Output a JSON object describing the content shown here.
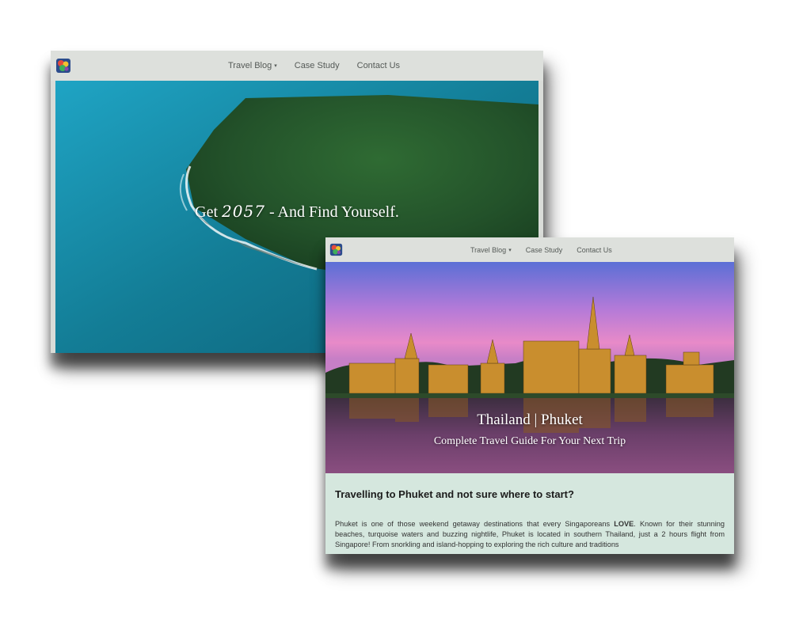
{
  "back_window": {
    "nav": {
      "items": [
        {
          "label": "Travel Blog",
          "has_dropdown": true
        },
        {
          "label": "Case Study"
        },
        {
          "label": "Contact Us"
        }
      ]
    },
    "hero": {
      "title_prefix": "Get ",
      "brand": "2057",
      "title_suffix": " - And Find Yourself."
    }
  },
  "front_window": {
    "nav": {
      "items": [
        {
          "label": "Travel Blog",
          "has_dropdown": true
        },
        {
          "label": "Case Study"
        },
        {
          "label": "Contact Us"
        }
      ]
    },
    "hero": {
      "title": "Thailand | Phuket",
      "subtitle": "Complete Travel Guide For Your Next Trip"
    },
    "article": {
      "heading": "Travelling to Phuket and not sure where to start?",
      "body_before_emphasis": "Phuket is one of those weekend getaway destinations that every Singaporeans ",
      "emphasis": "LOVE",
      "body_after_emphasis": ". Known for their stunning beaches, turquoise waters and buzzing nightlife, Phuket is located in southern Thailand, just a 2 hours flight from Singapore! From snorkling and island-hopping to exploring the rich culture and traditions"
    }
  },
  "caret_glyph": "▾",
  "colors": {
    "navbar_bg": "#dde0dc",
    "article_bg": "#d5e7de",
    "ocean": "#1b7e95"
  }
}
